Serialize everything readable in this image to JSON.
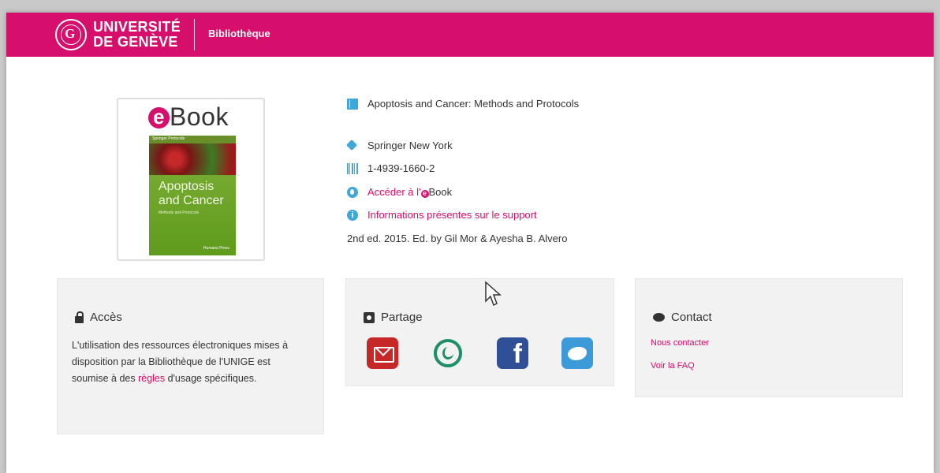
{
  "header": {
    "university_line1": "UNIVERSITÉ",
    "university_line2": "DE GENÈVE",
    "section": "Bibliothèque",
    "brand_color": "#d60e6c"
  },
  "cover": {
    "badge_letter": "e",
    "badge_word": "Book",
    "series": "Springer Protocols",
    "title_line1": "Apoptosis",
    "title_line2": "and Cancer",
    "subtitle": "Methods and Protocols",
    "publisher": "Humana Press"
  },
  "record": {
    "title": "Apoptosis and Cancer: Methods and Protocols",
    "publisher": "Springer New York",
    "isbn": "1-4939-1660-2",
    "access_link_prefix": "Accéder à l'",
    "access_link_e": "e",
    "access_link_suffix": "Book",
    "support_info_link": "Informations présentes sur le support",
    "edition_note": "2nd ed. 2015. Ed. by Gil Mor & Ayesha B. Alvero"
  },
  "access_card": {
    "title": "Accès",
    "text_before": "L'utilisation des ressources électroniques mises à disposition par la Bibliothèque de l'UNIGE est soumise à des ",
    "link": "règles",
    "text_after": " d'usage spécifiques."
  },
  "share_card": {
    "title": "Partage",
    "buttons": [
      "email-icon",
      "whatsapp-icon",
      "facebook-icon",
      "twitter-icon"
    ],
    "facebook_glyph": "f"
  },
  "contact_card": {
    "title": "Contact",
    "link1": "Nous contacter",
    "link2": "Voir la FAQ"
  }
}
